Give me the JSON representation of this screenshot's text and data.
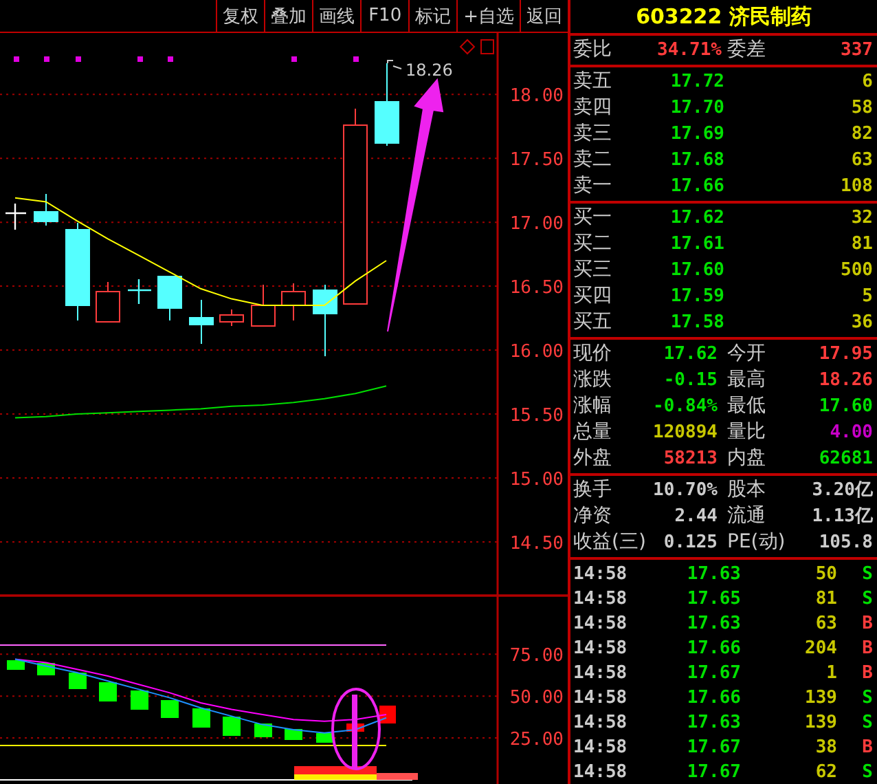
{
  "toolbar": [
    {
      "label": "复权"
    },
    {
      "label": "叠加"
    },
    {
      "label": "画线"
    },
    {
      "label": "F10"
    },
    {
      "label": "标记"
    },
    {
      "label": "+自选"
    },
    {
      "label": "返回"
    }
  ],
  "chart": {
    "chart_data": {
      "type": "line",
      "grid": true,
      "ylim": [
        14.08,
        18.48
      ],
      "yticks": [
        {
          "value": 18,
          "label": "18.00"
        },
        {
          "value": 17.5,
          "label": "17.50"
        },
        {
          "value": 17,
          "label": "17.00"
        },
        {
          "value": 16.5,
          "label": "16.50"
        },
        {
          "value": 16,
          "label": "16.00"
        },
        {
          "value": 15.5,
          "label": "15.50"
        },
        {
          "value": 15,
          "label": "15.00"
        },
        {
          "value": 14.5,
          "label": "14.50"
        }
      ],
      "series": [
        {
          "color": "#ffff00",
          "values": [
            17.19,
            17.16,
            17.01,
            16.87,
            16.74,
            16.61,
            16.48,
            16.4,
            16.35,
            16.35,
            16.35,
            16.54,
            16.7
          ]
        },
        {
          "color": "#00e000",
          "values": [
            15.47,
            15.48,
            15.5,
            15.51,
            15.52,
            15.53,
            15.54,
            15.56,
            15.57,
            15.59,
            15.62,
            15.66,
            15.72
          ]
        }
      ]
    },
    "high_label": "18.26"
  },
  "indicator": {
    "chart_data": {
      "type": "line",
      "grid": true,
      "ylim": [
        0,
        110
      ],
      "yticks": [
        {
          "value": 75,
          "label": "75.00"
        },
        {
          "value": 50,
          "label": "50.00"
        },
        {
          "value": 25,
          "label": "25.00"
        }
      ],
      "series": [
        {
          "color": "#ff00ff",
          "values": [
            72,
            70,
            66,
            62,
            57,
            52,
            46,
            42,
            39,
            36,
            35,
            36,
            39
          ]
        },
        {
          "color": "#1e90ff",
          "values": [
            72,
            68,
            64,
            59,
            54,
            49,
            43,
            38,
            33,
            30,
            28,
            30,
            37
          ]
        }
      ]
    }
  },
  "quote": {
    "code": "603222",
    "name": "济民制药",
    "weibi": {
      "label": "委比",
      "value": "34.71%",
      "label2": "委差",
      "value2": "337"
    },
    "asks": [
      {
        "label": "卖五",
        "price": "17.72",
        "volume": "6"
      },
      {
        "label": "卖四",
        "price": "17.70",
        "volume": "58"
      },
      {
        "label": "卖三",
        "price": "17.69",
        "volume": "82"
      },
      {
        "label": "卖二",
        "price": "17.68",
        "volume": "63"
      },
      {
        "label": "卖一",
        "price": "17.66",
        "volume": "108"
      }
    ],
    "bids": [
      {
        "label": "买一",
        "price": "17.62",
        "volume": "32"
      },
      {
        "label": "买二",
        "price": "17.61",
        "volume": "81"
      },
      {
        "label": "买三",
        "price": "17.60",
        "volume": "500"
      },
      {
        "label": "买四",
        "price": "17.59",
        "volume": "5"
      },
      {
        "label": "买五",
        "price": "17.58",
        "volume": "36"
      }
    ],
    "stats": [
      [
        {
          "label": "现价",
          "value": "17.62",
          "color": "#00e000"
        },
        {
          "label": "今开",
          "value": "17.95",
          "color": "#ff3c3c"
        }
      ],
      [
        {
          "label": "涨跌",
          "value": "-0.15",
          "color": "#00e000"
        },
        {
          "label": "最高",
          "value": "18.26",
          "color": "#ff3c3c"
        }
      ],
      [
        {
          "label": "涨幅",
          "value": "-0.84%",
          "color": "#00e000"
        },
        {
          "label": "最低",
          "value": "17.60",
          "color": "#00e000"
        }
      ],
      [
        {
          "label": "总量",
          "value": "120894",
          "color": "#c8c800"
        },
        {
          "label": "量比",
          "value": "4.00",
          "color": "#c800c8"
        }
      ],
      [
        {
          "label": "外盘",
          "value": "58213",
          "color": "#ff3c3c"
        },
        {
          "label": "内盘",
          "value": "62681",
          "color": "#00e000"
        }
      ]
    ],
    "fundamentals": [
      [
        {
          "label": "换手",
          "value": "10.70%"
        },
        {
          "label": "股本",
          "value": "3.20亿"
        }
      ],
      [
        {
          "label": "净资",
          "value": "2.44"
        },
        {
          "label": "流通",
          "value": "1.13亿"
        }
      ],
      [
        {
          "label": "收益(三)",
          "value": "0.125"
        },
        {
          "label": "PE(动)",
          "value": "105.8"
        }
      ]
    ],
    "trades": [
      {
        "time": "14:58",
        "price": "17.63",
        "volume": "50",
        "side": "S",
        "color": "#00e000"
      },
      {
        "time": "14:58",
        "price": "17.65",
        "volume": "81",
        "side": "S",
        "color": "#00e000"
      },
      {
        "time": "14:58",
        "price": "17.63",
        "volume": "63",
        "side": "B",
        "color": "#ff3c3c"
      },
      {
        "time": "14:58",
        "price": "17.66",
        "volume": "204",
        "side": "B",
        "color": "#ff3c3c"
      },
      {
        "time": "14:58",
        "price": "17.67",
        "volume": "1",
        "side": "B",
        "color": "#ff3c3c"
      },
      {
        "time": "14:58",
        "price": "17.66",
        "volume": "139",
        "side": "S",
        "color": "#00e000"
      },
      {
        "time": "14:58",
        "price": "17.63",
        "volume": "139",
        "side": "S",
        "color": "#00e000"
      },
      {
        "time": "14:58",
        "price": "17.67",
        "volume": "38",
        "side": "B",
        "color": "#ff3c3c"
      },
      {
        "time": "14:58",
        "price": "17.67",
        "volume": "62",
        "side": "S",
        "color": "#00e000"
      }
    ]
  }
}
